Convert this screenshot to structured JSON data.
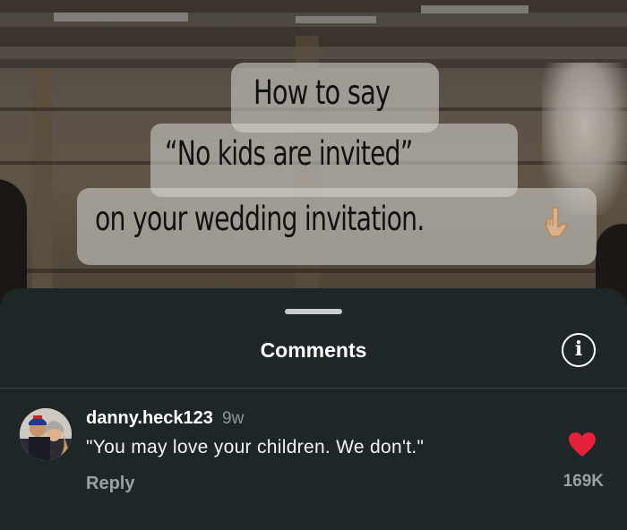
{
  "post": {
    "caption_lines": [
      "How to say",
      "“No kids are invited”",
      "on your wedding invitation."
    ],
    "caption_emoji": "pointing-down-hand-icon"
  },
  "comments_sheet": {
    "title": "Comments",
    "info_icon": "info-icon",
    "info_glyph": "i"
  },
  "comment": {
    "username": "danny.heck123",
    "time_ago": "9w",
    "text": "\"You may love your children. We don't.\"",
    "reply_label": "Reply",
    "like_icon": "heart-icon",
    "like_count": "169K",
    "liked": true
  },
  "colors": {
    "sheet_background": "#1f2628",
    "heart": "#e5213a",
    "caption_box": "#d2d2cd"
  }
}
